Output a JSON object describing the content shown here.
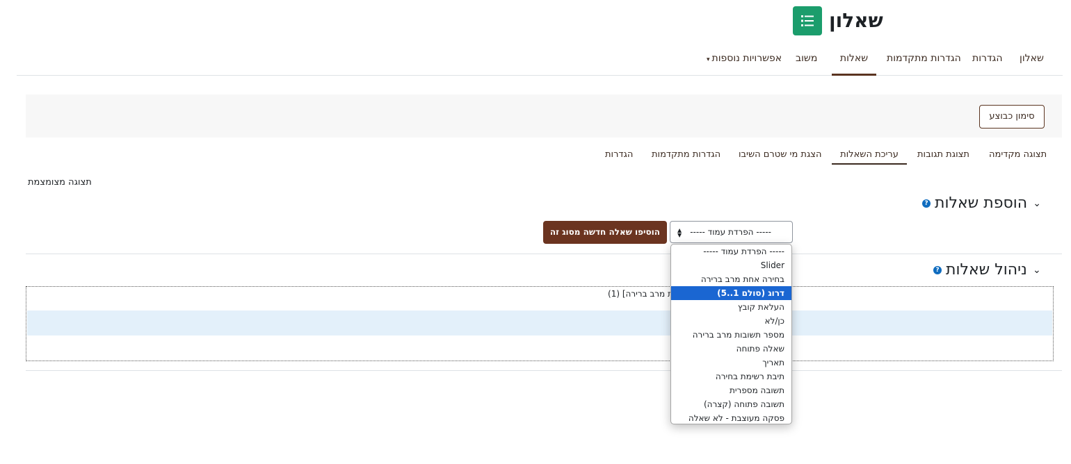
{
  "header": {
    "title": "שאלון",
    "icon": "list-icon",
    "accent": "#1b9d6c"
  },
  "primary_nav": [
    {
      "label": "שאלון",
      "active": false
    },
    {
      "label": "הגדרות",
      "active": false
    },
    {
      "label": "הגדרות מתקדמות",
      "active": false
    },
    {
      "label": "שאלות",
      "active": true
    },
    {
      "label": "משוב",
      "active": false
    },
    {
      "label": "אפשרויות נוספות",
      "active": false
    }
  ],
  "action_bar": {
    "mark_done_label": "סימון כבוצע"
  },
  "secondary_nav": [
    {
      "label": "תצוגה מקדימה",
      "active": false
    },
    {
      "label": "תצוגת תגובות",
      "active": false
    },
    {
      "label": "עריכת השאלות",
      "active": true
    },
    {
      "label": "הצגת מי שטרם השיבו",
      "active": false
    },
    {
      "label": "הגדרות מתקדמות",
      "active": false
    },
    {
      "label": "הגדרות",
      "active": false
    }
  ],
  "compact_view_label": "תצוגה מצומצמת",
  "add_section": {
    "title": "הוספת שאלות",
    "select_value": "----- הפרדת עמוד -----",
    "add_button_label": "הוסיפו שאלה חדשה מסוג זה"
  },
  "manage_section": {
    "title": "ניהול שאלות",
    "question_row_text": "ת מרב ברירה] (1)"
  },
  "dropdown_options": [
    {
      "label": "----- הפרדת עמוד -----",
      "selected": false
    },
    {
      "label": "Slider",
      "selected": false
    },
    {
      "label": "בחירה אחת מרב ברירה",
      "selected": false
    },
    {
      "label": "דרוג (סולם 1..5)",
      "selected": true
    },
    {
      "label": "העלאת קובץ",
      "selected": false
    },
    {
      "label": "כן/לא",
      "selected": false
    },
    {
      "label": "מספר תשובות מרב ברירה",
      "selected": false
    },
    {
      "label": "שאלה פתוחה",
      "selected": false
    },
    {
      "label": "תאריך",
      "selected": false
    },
    {
      "label": "תיבת רשימת בחירה",
      "selected": false
    },
    {
      "label": "תשובה מספרית",
      "selected": false
    },
    {
      "label": "תשובה פתוחה (קצרה)",
      "selected": false
    },
    {
      "label": "פסקה מעוצבת - לא שאלה",
      "selected": false
    }
  ],
  "colors": {
    "brand_button": "#6b3420",
    "selection": "#1a66d2",
    "help": "#0f6cbf"
  }
}
